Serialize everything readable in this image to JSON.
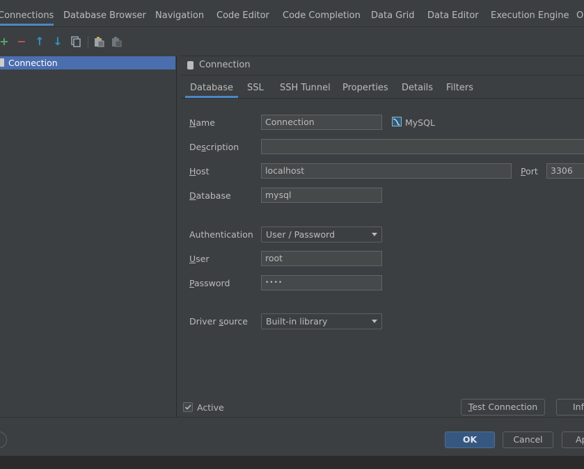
{
  "top_tabs": [
    "Connections",
    "Database Browser",
    "Navigation",
    "Code Editor",
    "Code Completion",
    "Data Grid",
    "Data Editor",
    "Execution Engine",
    "O"
  ],
  "toolbar": {
    "add": "+",
    "remove": "−",
    "up": "↑",
    "down": "↓"
  },
  "tree": {
    "selected_item": "Connection"
  },
  "panel": {
    "title": "Connection",
    "tabs": [
      "Database",
      "SSL",
      "SSH Tunnel",
      "Properties",
      "Details",
      "Filters"
    ]
  },
  "form": {
    "name_label_u": "N",
    "name_label_rest": "ame",
    "name_value": "Connection",
    "db_type": "MySQL",
    "description_label_pre": "De",
    "description_label_u": "s",
    "description_label_rest": "cription",
    "description_value": "",
    "host_label_u": "H",
    "host_label_rest": "ost",
    "host_value": "localhost",
    "port_label_u": "P",
    "port_label_rest": "ort",
    "port_value": "3306",
    "database_label_u": "D",
    "database_label_rest": "atabase",
    "database_value": "mysql",
    "auth_label": "Authentication",
    "auth_value": "User / Password",
    "user_label_u": "U",
    "user_label_rest": "ser",
    "user_value": "root",
    "password_label_u": "P",
    "password_label_rest": "assword",
    "password_value": "••••",
    "driver_label_pre": "Driver ",
    "driver_label_u": "s",
    "driver_label_rest": "ource",
    "driver_value": "Built-in library",
    "active_label": "Active",
    "active_checked": true
  },
  "buttons": {
    "test_u": "T",
    "test_rest": "est Connection",
    "info": "Inf",
    "ok": "OK",
    "cancel": "Cancel",
    "apply": "Ap"
  }
}
